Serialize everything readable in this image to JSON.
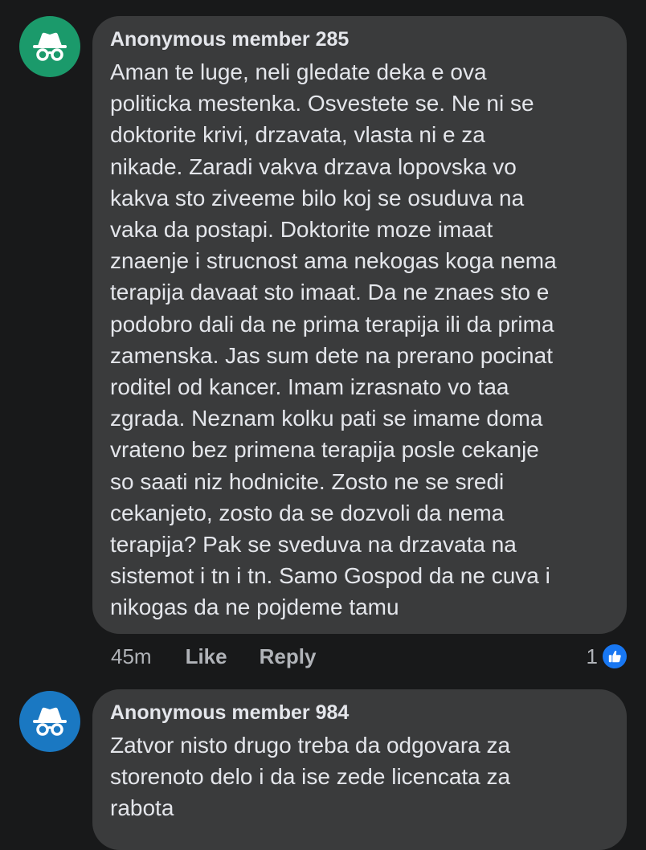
{
  "comments": [
    {
      "author": "Anonymous member 285",
      "avatar_color": "#1b9a6b",
      "avatar_icon": "incognito-icon",
      "text": "Aman te luge, neli gledate deka e ova\npoliticka mestenka. Osvestete se. Ne ni se\ndoktorite krivi, drzavata, vlasta ni e za\nnikade. Zaradi vakva drzava lopovska vo\nkakva sto ziveeme bilo koj se osuduva na\nvaka da postapi. Doktorite moze imaat\nznaenje i strucnost ama nekogas koga nema\nterapija davaat sto imaat. Da ne znaes sto e\npodobro dali da ne prima terapija ili da prima\nzamenska. Jas sum dete na prerano pocinat\nroditel od kancer. Imam izrasnato vo taa\nzgrada. Neznam kolku pati se imame doma\nvrateno bez primena terapija posle cekanje\nso saati niz hodnicite. Zosto ne se sredi\ncekanjeto, zosto da se dozvoli da nema\nterapija? Pak se sveduva na drzavata na\nsistemot i tn i tn. Samo Gospod da ne cuva i\nnikogas da ne pojdeme tamu",
      "time": "45m",
      "like_label": "Like",
      "reply_label": "Reply",
      "reaction_count": "1",
      "reaction_color": "#1877f2"
    },
    {
      "author": "Anonymous member 984",
      "avatar_color": "#1a78c2",
      "avatar_icon": "incognito-icon",
      "text": "Zatvor nisto drugo treba da odgovara za\nstorenoto delo i da ise zede licencata za\nrabota"
    }
  ]
}
